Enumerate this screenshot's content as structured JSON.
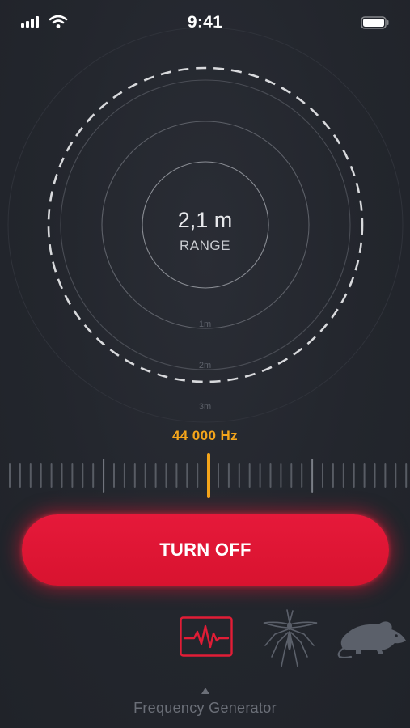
{
  "status_bar": {
    "time": "9:41",
    "icons": [
      "cellular-signal-icon",
      "wifi-icon",
      "battery-icon"
    ]
  },
  "range": {
    "value": "2,1 m",
    "label": "RANGE",
    "ring_labels": [
      "1m",
      "2m",
      "3m"
    ]
  },
  "frequency": {
    "readout": "44 000 Hz"
  },
  "action_button": {
    "label": "TURN OFF"
  },
  "modes": {
    "items": [
      {
        "name": "frequency-generator-icon",
        "selected": true
      },
      {
        "name": "mosquito-icon",
        "selected": false
      },
      {
        "name": "rodent-icon",
        "selected": false
      }
    ],
    "current_label": "Frequency Generator"
  },
  "colors": {
    "background": "#22252c",
    "accent_orange": "#f4a51b",
    "accent_red": "#e6193a",
    "muted_icon": "#5b606a"
  }
}
